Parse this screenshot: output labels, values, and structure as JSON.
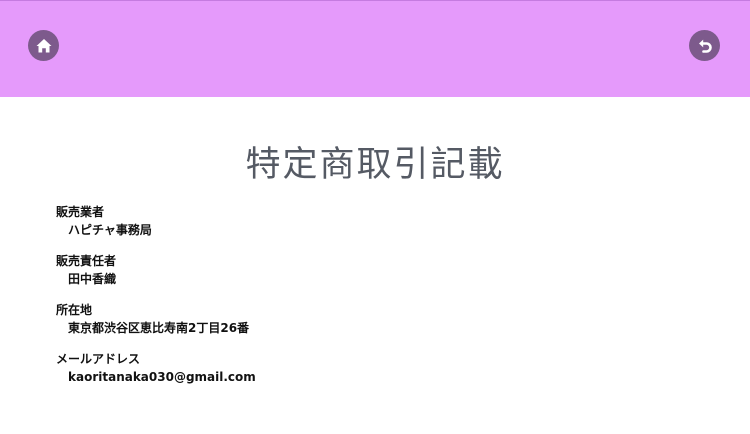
{
  "header": {
    "background_color": "#e59afb",
    "home_icon": "home-icon",
    "back_icon": "undo-arrow-icon",
    "icon_circle_color": "#7d5a8c"
  },
  "page": {
    "title": "特定商取引記載"
  },
  "fields": [
    {
      "label": "販売業者",
      "value": "ハピチャ事務局"
    },
    {
      "label": "販売責任者",
      "value": "田中香織"
    },
    {
      "label": "所在地",
      "value": "東京都渋谷区恵比寿南2丁目26番"
    },
    {
      "label": "メールアドレス",
      "value": "kaoritanaka030@gmail.com"
    }
  ]
}
